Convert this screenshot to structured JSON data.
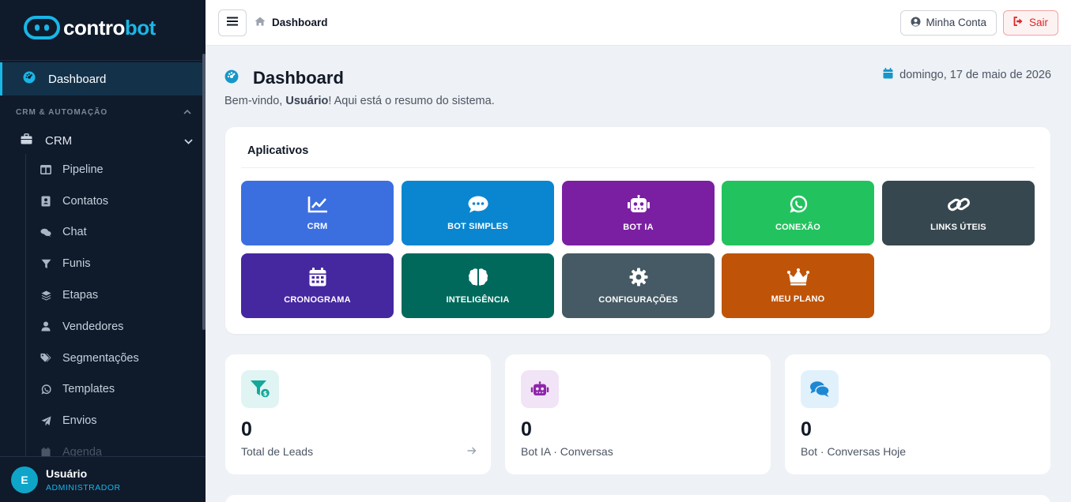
{
  "brand": {
    "name_part1": "contro",
    "name_part2": "bot"
  },
  "sidebar": {
    "active_item": "Dashboard",
    "section_title": "CRM & AUTOMAÇÃO",
    "group_label": "CRM",
    "items": [
      {
        "label": "Pipeline",
        "icon": "columns-icon"
      },
      {
        "label": "Contatos",
        "icon": "address-book-icon"
      },
      {
        "label": "Chat",
        "icon": "chat-icon"
      },
      {
        "label": "Funis",
        "icon": "filter-icon"
      },
      {
        "label": "Etapas",
        "icon": "layers-icon"
      },
      {
        "label": "Vendedores",
        "icon": "user-icon"
      },
      {
        "label": "Segmentações",
        "icon": "tags-icon"
      },
      {
        "label": "Templates",
        "icon": "whatsapp-icon"
      },
      {
        "label": "Envios",
        "icon": "send-icon"
      },
      {
        "label": "Agenda",
        "icon": "calendar-icon"
      }
    ],
    "user": {
      "initial": "E",
      "name": "Usuário",
      "role": "ADMINISTRADOR"
    }
  },
  "topbar": {
    "breadcrumb": "Dashboard",
    "account_label": "Minha Conta",
    "exit_label": "Sair"
  },
  "page": {
    "title": "Dashboard",
    "welcome_prefix": "Bem-vindo, ",
    "welcome_user": "Usuário",
    "welcome_suffix": "! Aqui está o resumo do sistema.",
    "date": "domingo, 17 de maio de 2026"
  },
  "apps": {
    "title": "Aplicativos",
    "tiles": [
      {
        "label": "CRM",
        "color": "#3b6fe0",
        "icon": "chart-line-icon"
      },
      {
        "label": "BOT SIMPLES",
        "color": "#0a86d0",
        "icon": "comment-dots-icon"
      },
      {
        "label": "BOT IA",
        "color": "#7b1fa2",
        "icon": "robot-icon"
      },
      {
        "label": "CONEXÃO",
        "color": "#22c35e",
        "icon": "whatsapp-icon"
      },
      {
        "label": "LINKS ÚTEIS",
        "color": "#37474f",
        "icon": "link-icon"
      },
      {
        "label": "CRONOGRAMA",
        "color": "#4527a0",
        "icon": "calendar-icon"
      },
      {
        "label": "INTELIGÊNCIA",
        "color": "#00695c",
        "icon": "brain-icon"
      },
      {
        "label": "CONFIGURAÇÕES",
        "color": "#455a64",
        "icon": "gear-icon"
      },
      {
        "label": "MEU PLANO",
        "color": "#bf5408",
        "icon": "crown-icon"
      }
    ]
  },
  "stats": [
    {
      "value": "0",
      "label": "Total de Leads",
      "icon": "funnel-dollar-icon",
      "icon_bg": "#e0f5f3",
      "icon_color": "#14a89a"
    },
    {
      "value": "0",
      "label": "Bot IA · Conversas",
      "icon": "robot-icon",
      "icon_bg": "#f1e4f6",
      "icon_color": "#8e24aa"
    },
    {
      "value": "0",
      "label": "Bot · Conversas Hoje",
      "icon": "comments-icon",
      "icon_bg": "#e1f1fb",
      "icon_color": "#1c88d4"
    }
  ]
}
